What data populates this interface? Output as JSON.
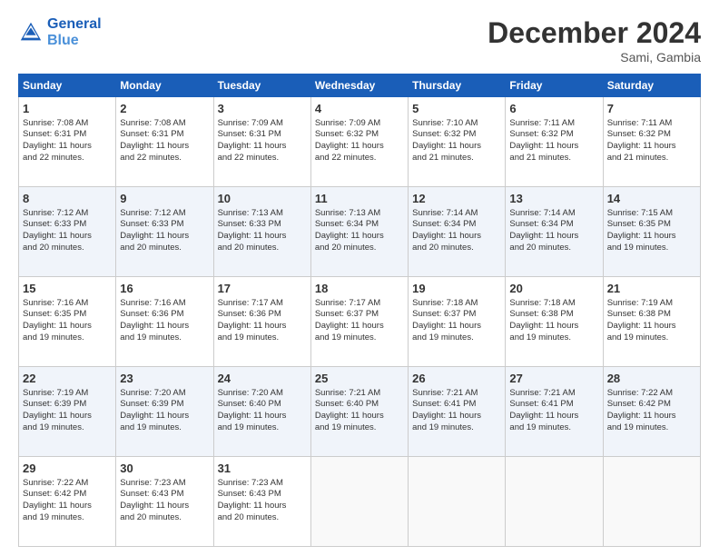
{
  "logo": {
    "line1": "General",
    "line2": "Blue"
  },
  "title": "December 2024",
  "subtitle": "Sami, Gambia",
  "days_header": [
    "Sunday",
    "Monday",
    "Tuesday",
    "Wednesday",
    "Thursday",
    "Friday",
    "Saturday"
  ],
  "weeks": [
    [
      {
        "num": "1",
        "lines": [
          "Sunrise: 7:08 AM",
          "Sunset: 6:31 PM",
          "Daylight: 11 hours",
          "and 22 minutes."
        ]
      },
      {
        "num": "2",
        "lines": [
          "Sunrise: 7:08 AM",
          "Sunset: 6:31 PM",
          "Daylight: 11 hours",
          "and 22 minutes."
        ]
      },
      {
        "num": "3",
        "lines": [
          "Sunrise: 7:09 AM",
          "Sunset: 6:31 PM",
          "Daylight: 11 hours",
          "and 22 minutes."
        ]
      },
      {
        "num": "4",
        "lines": [
          "Sunrise: 7:09 AM",
          "Sunset: 6:32 PM",
          "Daylight: 11 hours",
          "and 22 minutes."
        ]
      },
      {
        "num": "5",
        "lines": [
          "Sunrise: 7:10 AM",
          "Sunset: 6:32 PM",
          "Daylight: 11 hours",
          "and 21 minutes."
        ]
      },
      {
        "num": "6",
        "lines": [
          "Sunrise: 7:11 AM",
          "Sunset: 6:32 PM",
          "Daylight: 11 hours",
          "and 21 minutes."
        ]
      },
      {
        "num": "7",
        "lines": [
          "Sunrise: 7:11 AM",
          "Sunset: 6:32 PM",
          "Daylight: 11 hours",
          "and 21 minutes."
        ]
      }
    ],
    [
      {
        "num": "8",
        "lines": [
          "Sunrise: 7:12 AM",
          "Sunset: 6:33 PM",
          "Daylight: 11 hours",
          "and 20 minutes."
        ]
      },
      {
        "num": "9",
        "lines": [
          "Sunrise: 7:12 AM",
          "Sunset: 6:33 PM",
          "Daylight: 11 hours",
          "and 20 minutes."
        ]
      },
      {
        "num": "10",
        "lines": [
          "Sunrise: 7:13 AM",
          "Sunset: 6:33 PM",
          "Daylight: 11 hours",
          "and 20 minutes."
        ]
      },
      {
        "num": "11",
        "lines": [
          "Sunrise: 7:13 AM",
          "Sunset: 6:34 PM",
          "Daylight: 11 hours",
          "and 20 minutes."
        ]
      },
      {
        "num": "12",
        "lines": [
          "Sunrise: 7:14 AM",
          "Sunset: 6:34 PM",
          "Daylight: 11 hours",
          "and 20 minutes."
        ]
      },
      {
        "num": "13",
        "lines": [
          "Sunrise: 7:14 AM",
          "Sunset: 6:34 PM",
          "Daylight: 11 hours",
          "and 20 minutes."
        ]
      },
      {
        "num": "14",
        "lines": [
          "Sunrise: 7:15 AM",
          "Sunset: 6:35 PM",
          "Daylight: 11 hours",
          "and 19 minutes."
        ]
      }
    ],
    [
      {
        "num": "15",
        "lines": [
          "Sunrise: 7:16 AM",
          "Sunset: 6:35 PM",
          "Daylight: 11 hours",
          "and 19 minutes."
        ]
      },
      {
        "num": "16",
        "lines": [
          "Sunrise: 7:16 AM",
          "Sunset: 6:36 PM",
          "Daylight: 11 hours",
          "and 19 minutes."
        ]
      },
      {
        "num": "17",
        "lines": [
          "Sunrise: 7:17 AM",
          "Sunset: 6:36 PM",
          "Daylight: 11 hours",
          "and 19 minutes."
        ]
      },
      {
        "num": "18",
        "lines": [
          "Sunrise: 7:17 AM",
          "Sunset: 6:37 PM",
          "Daylight: 11 hours",
          "and 19 minutes."
        ]
      },
      {
        "num": "19",
        "lines": [
          "Sunrise: 7:18 AM",
          "Sunset: 6:37 PM",
          "Daylight: 11 hours",
          "and 19 minutes."
        ]
      },
      {
        "num": "20",
        "lines": [
          "Sunrise: 7:18 AM",
          "Sunset: 6:38 PM",
          "Daylight: 11 hours",
          "and 19 minutes."
        ]
      },
      {
        "num": "21",
        "lines": [
          "Sunrise: 7:19 AM",
          "Sunset: 6:38 PM",
          "Daylight: 11 hours",
          "and 19 minutes."
        ]
      }
    ],
    [
      {
        "num": "22",
        "lines": [
          "Sunrise: 7:19 AM",
          "Sunset: 6:39 PM",
          "Daylight: 11 hours",
          "and 19 minutes."
        ]
      },
      {
        "num": "23",
        "lines": [
          "Sunrise: 7:20 AM",
          "Sunset: 6:39 PM",
          "Daylight: 11 hours",
          "and 19 minutes."
        ]
      },
      {
        "num": "24",
        "lines": [
          "Sunrise: 7:20 AM",
          "Sunset: 6:40 PM",
          "Daylight: 11 hours",
          "and 19 minutes."
        ]
      },
      {
        "num": "25",
        "lines": [
          "Sunrise: 7:21 AM",
          "Sunset: 6:40 PM",
          "Daylight: 11 hours",
          "and 19 minutes."
        ]
      },
      {
        "num": "26",
        "lines": [
          "Sunrise: 7:21 AM",
          "Sunset: 6:41 PM",
          "Daylight: 11 hours",
          "and 19 minutes."
        ]
      },
      {
        "num": "27",
        "lines": [
          "Sunrise: 7:21 AM",
          "Sunset: 6:41 PM",
          "Daylight: 11 hours",
          "and 19 minutes."
        ]
      },
      {
        "num": "28",
        "lines": [
          "Sunrise: 7:22 AM",
          "Sunset: 6:42 PM",
          "Daylight: 11 hours",
          "and 19 minutes."
        ]
      }
    ],
    [
      {
        "num": "29",
        "lines": [
          "Sunrise: 7:22 AM",
          "Sunset: 6:42 PM",
          "Daylight: 11 hours",
          "and 19 minutes."
        ]
      },
      {
        "num": "30",
        "lines": [
          "Sunrise: 7:23 AM",
          "Sunset: 6:43 PM",
          "Daylight: 11 hours",
          "and 20 minutes."
        ]
      },
      {
        "num": "31",
        "lines": [
          "Sunrise: 7:23 AM",
          "Sunset: 6:43 PM",
          "Daylight: 11 hours",
          "and 20 minutes."
        ]
      },
      null,
      null,
      null,
      null
    ]
  ]
}
